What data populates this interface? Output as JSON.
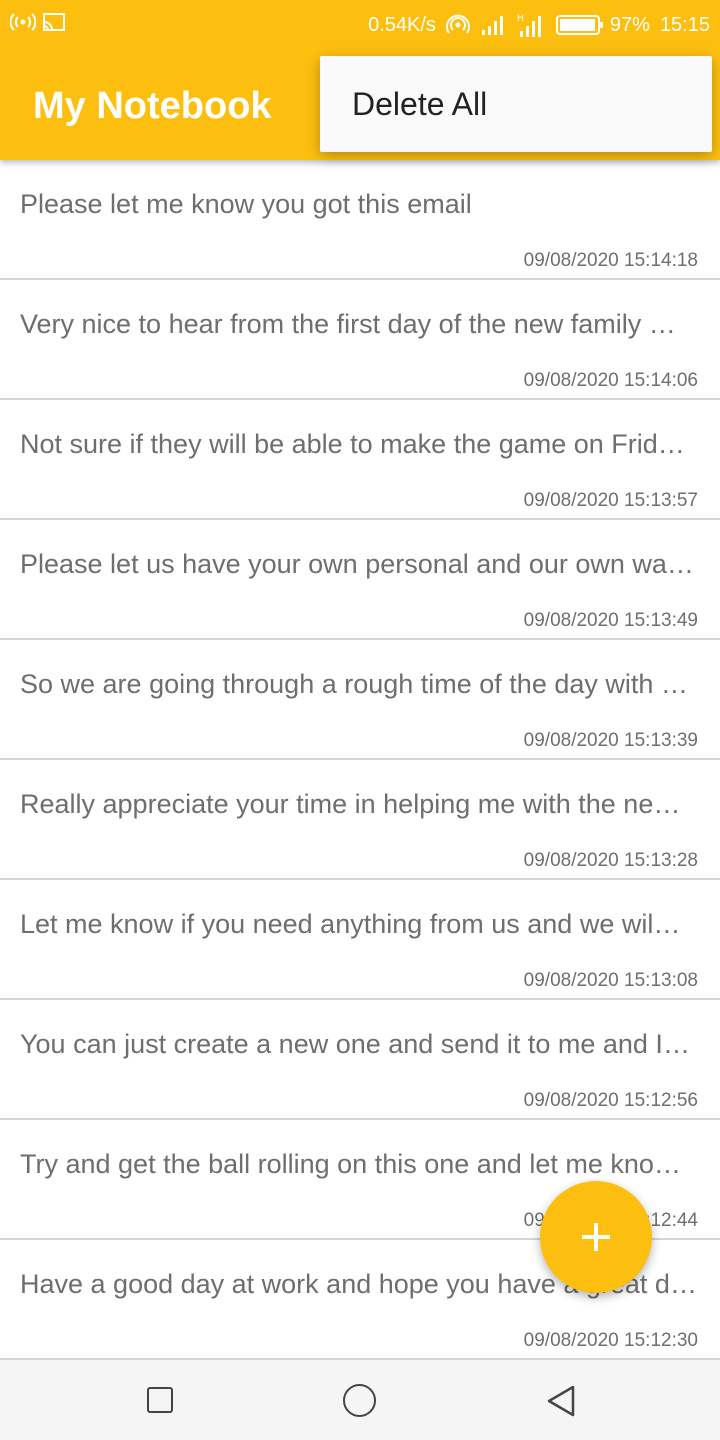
{
  "status_bar": {
    "speed": "0.54K/s",
    "battery": "97%",
    "time": "15:15",
    "icons": [
      "hotspot-icon",
      "screencast-icon",
      "hotspot-signal-icon",
      "signal-icon",
      "signal-h-icon"
    ]
  },
  "app": {
    "title": "My Notebook",
    "accent_color": "#FDBF0F"
  },
  "menu": {
    "items": [
      {
        "label": "Delete All"
      }
    ]
  },
  "notes": [
    {
      "text": "Please let me know you got this email",
      "date": "09/08/2020 15:14:18"
    },
    {
      "text": "Very nice to hear from the first day of the new family …",
      "date": "09/08/2020 15:14:06"
    },
    {
      "text": "Not sure if they will be able to make the game on Frid…",
      "date": "09/08/2020 15:13:57"
    },
    {
      "text": "Please let us have your own personal and our own wa…",
      "date": "09/08/2020 15:13:49"
    },
    {
      "text": "So we are going through a rough time of the day with …",
      "date": "09/08/2020 15:13:39"
    },
    {
      "text": "Really appreciate your time in helping me with the ne…",
      "date": "09/08/2020 15:13:28"
    },
    {
      "text": "Let me know if you need anything from us and we wil…",
      "date": "09/08/2020 15:13:08"
    },
    {
      "text": "You can just create a new one and send it to me and I…",
      "date": "09/08/2020 15:12:56"
    },
    {
      "text": "Try and get the ball rolling on this one and let me kno…",
      "date": "09/08/2020 15:12:44"
    },
    {
      "text": "Have a good day at work and hope you have a great d…",
      "date": "09/08/2020 15:12:30"
    }
  ],
  "fab": {
    "icon": "plus-icon"
  },
  "navbar": {
    "icons": [
      "recents-icon",
      "home-icon",
      "back-icon"
    ]
  }
}
